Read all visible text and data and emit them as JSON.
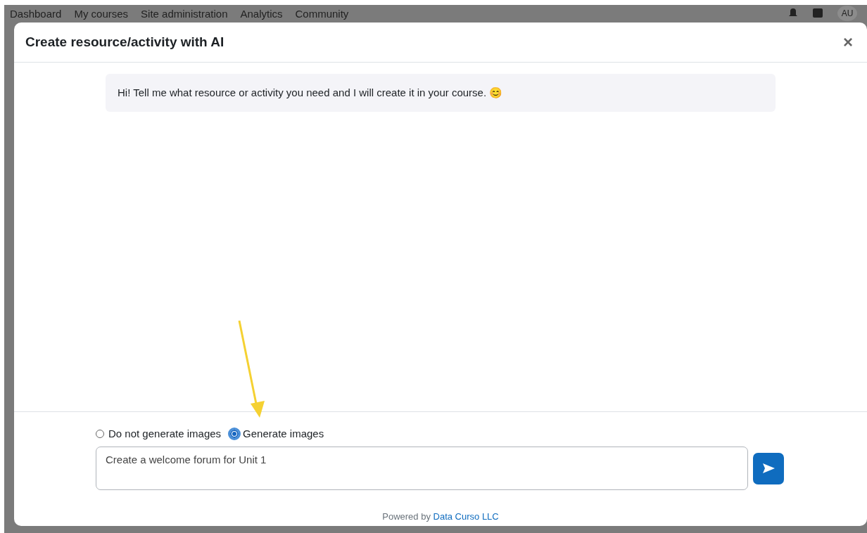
{
  "background_nav": {
    "items": [
      "Dashboard",
      "My courses",
      "Site administration",
      "Analytics",
      "Community"
    ],
    "avatar": "AU"
  },
  "modal": {
    "title": "Create resource/activity with AI",
    "close": "×",
    "messages": [
      {
        "text": "Hi! Tell me what resource or activity you need and I will create it in your course. 😊"
      }
    ],
    "image_options": [
      {
        "label": "Do not generate images",
        "selected": false
      },
      {
        "label": "Generate images",
        "selected": true
      }
    ],
    "prompt": {
      "value": "Create a welcome forum for Unit 1"
    },
    "footer": {
      "prefix": "Powered by",
      "link": "Data Curso LLC"
    }
  }
}
